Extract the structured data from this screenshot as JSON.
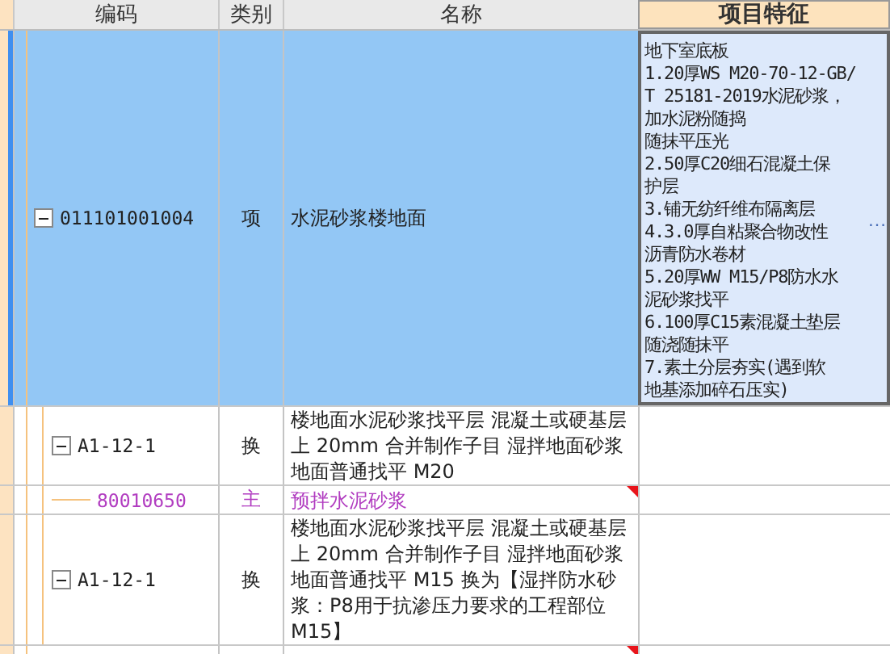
{
  "columns": [
    "编码",
    "类别",
    "名称",
    "项目特征"
  ],
  "item": {
    "code": "011101001004",
    "type": "项",
    "name": "水泥砂浆楼地面",
    "selected": true,
    "expanded": true,
    "more": "…",
    "features": [
      "地下室底板",
      "1.20厚WS M20-70-12-GB/",
      "T 25181-2019水泥砂浆，",
      "加水泥粉随捣",
      "随抹平压光",
      "2.50厚C20细石混凝土保",
      "护层",
      "3.铺无纺纤维布隔离层",
      "4.3.0厚自粘聚合物改性",
      "沥青防水卷材",
      "5.20厚WW M15/P8防水水",
      "泥砂浆找平",
      "6.100厚C15素混凝土垫层",
      "随浇随抹平",
      "7.素土分层夯实(遇到软",
      "地基添加碎石压实)"
    ]
  },
  "rows": [
    {
      "kind": "quota",
      "code": "A1-12-1",
      "type": "换",
      "name": "楼地面水泥砂浆找平层 混凝土或硬基层上 20mm  合并制作子目 湿拌地面砂浆地面普通找平 M20",
      "expanded": true,
      "flagged": false
    },
    {
      "kind": "material",
      "code": "80010650",
      "type": "主",
      "name": "预拌水泥砂浆",
      "flagged": true
    },
    {
      "kind": "quota",
      "code": "A1-12-1",
      "type": "换",
      "name": "楼地面水泥砂浆找平层 混凝土或硬基层上 20mm  合并制作子目 湿拌地面砂浆地面普通找平 M15  换为【湿拌防水砂浆：P8用于抗渗压力要求的工程部位 M15】",
      "expanded": true,
      "flagged": false
    },
    {
      "kind": "material",
      "flagged": true
    }
  ]
}
